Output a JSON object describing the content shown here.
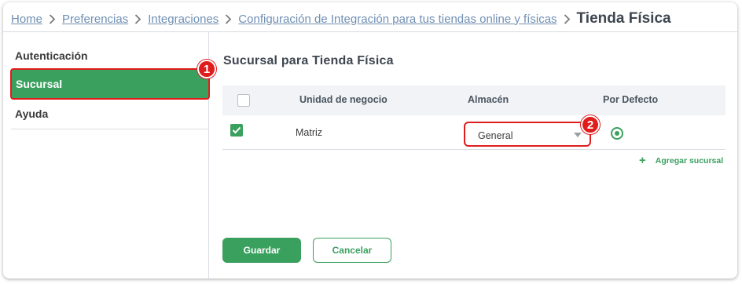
{
  "breadcrumb": {
    "items": [
      "Home",
      "Preferencias",
      "Integraciones",
      "Configuración de Integración para tus tiendas online y físicas"
    ],
    "current": "Tienda Física"
  },
  "sidebar": {
    "items": [
      {
        "label": "Autenticación",
        "selected": false
      },
      {
        "label": "Sucursal",
        "selected": true
      },
      {
        "label": "Ayuda",
        "selected": false
      }
    ]
  },
  "annotations": [
    "1",
    "2"
  ],
  "main": {
    "title": "Sucursal para Tienda Física",
    "table": {
      "headers": [
        "Unidad de negocio",
        "Almacén",
        "Por Defecto"
      ],
      "rows": [
        {
          "checked": true,
          "unit": "Matriz",
          "warehouse": "General",
          "default": true
        }
      ]
    },
    "add_branch_label": "Agregar sucursal",
    "add_branch_icon": "plus-icon",
    "save_label": "Guardar",
    "cancel_label": "Cancelar"
  },
  "colors": {
    "accent": "#3aa05e",
    "highlight": "#e01c1c",
    "link": "#6f8fb3"
  }
}
